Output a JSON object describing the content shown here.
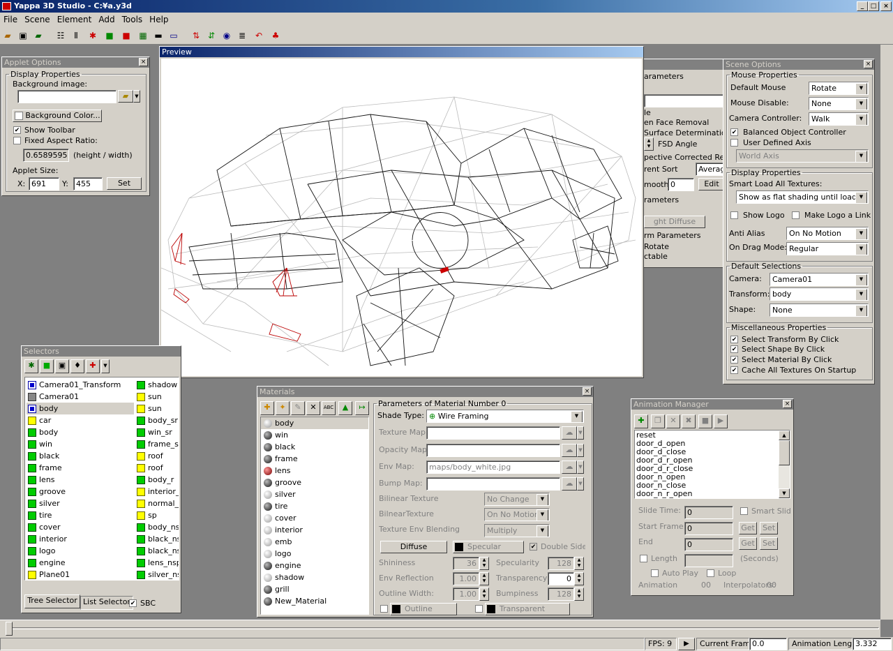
{
  "window": {
    "title": "Yappa 3D Studio - C:¥a.y3d"
  },
  "menu": [
    "File",
    "Scene",
    "Element",
    "Add",
    "Tools",
    "Help"
  ],
  "applet_options": {
    "title": "Applet Options",
    "display_properties": "Display Properties",
    "background_image_label": "Background image:",
    "background_image_value": "",
    "background_color_button": "Background Color...",
    "show_toolbar": "Show Toolbar",
    "fixed_aspect_ratio": "Fixed Aspect Ratio:",
    "ratio_value": "0.6589595",
    "ratio_hint": "(height / width)",
    "applet_size": "Applet Size:",
    "x_label": "X:",
    "x_value": "691",
    "y_label": "Y:",
    "y_value": "455",
    "set_button": "Set"
  },
  "preview": {
    "title": "Preview"
  },
  "hidden_panel": {
    "parameters": "arameters",
    "le": "le",
    "face_removal": "en Face Removal",
    "surface_det": "Surface Determination",
    "fsd_angle": "FSD Angle",
    "perspective": "pective Corrected Ren",
    "current_sort": "rent Sort",
    "sort_value": "Averag",
    "smooth": "mooth:",
    "smooth_value": "0",
    "edit_button": "Edit",
    "parameters2": "rameters",
    "light_diffuse": "ght Diffuse",
    "form_params": "rm Parameters",
    "rotate": "Rotate",
    "selectable": "ctable"
  },
  "scene_options": {
    "title": "Scene Options",
    "mouse_properties": "Mouse Properties",
    "default_mouse_label": "Default Mouse",
    "default_mouse": "Rotate",
    "mouse_disable_label": "Mouse Disable:",
    "mouse_disable": "None",
    "camera_controller_label": "Camera Controller:",
    "camera_controller": "Walk",
    "balanced": "Balanced Object Controller",
    "user_axis": "User Defined Axis",
    "world_axis": "World Axis",
    "display_properties": "Display Properties",
    "smart_load": "Smart Load All Textures:",
    "smart_load_value": "Show as flat shading until loaded",
    "show_logo": "Show Logo",
    "make_logo_link": "Make Logo a Link",
    "anti_alias_label": "Anti Alias",
    "anti_alias": "On No Motion",
    "on_drag_label": "On Drag Mode:",
    "on_drag": "Regular",
    "default_selections": "Default Selections",
    "camera_label": "Camera:",
    "camera": "Camera01",
    "transform_label": "Transform:",
    "transform": "body",
    "shape_label": "Shape:",
    "shape": "None",
    "misc": "Miscellaneous Properties",
    "sel_transform": "Select Transform By Click",
    "sel_shape": "Select Shape By Click",
    "sel_material": "Select Material By Click",
    "cache": "Cache All Textures On Startup"
  },
  "selectors": {
    "title": "Selectors",
    "col1": [
      {
        "name": "Camera01_Transform",
        "icon": "tr"
      },
      {
        "name": "Camera01",
        "icon": "cam"
      },
      {
        "name": "body",
        "icon": "tr"
      },
      {
        "name": "car",
        "icon": "light"
      },
      {
        "name": "body",
        "icon": "cube"
      },
      {
        "name": "win",
        "icon": "cube"
      },
      {
        "name": "black",
        "icon": "cube"
      },
      {
        "name": "frame",
        "icon": "cube"
      },
      {
        "name": "lens",
        "icon": "cube"
      },
      {
        "name": "groove",
        "icon": "cube"
      },
      {
        "name": "silver",
        "icon": "cube"
      },
      {
        "name": "tire",
        "icon": "cube"
      },
      {
        "name": "cover",
        "icon": "cube"
      },
      {
        "name": "interior",
        "icon": "cube"
      },
      {
        "name": "logo",
        "icon": "cube"
      },
      {
        "name": "engine",
        "icon": "cube"
      },
      {
        "name": "Plane01",
        "icon": "light"
      }
    ],
    "col2": [
      {
        "name": "shadow",
        "icon": "cube"
      },
      {
        "name": "sun",
        "icon": "light"
      },
      {
        "name": "sun",
        "icon": "light"
      },
      {
        "name": "body_sr",
        "icon": "cube"
      },
      {
        "name": "win_sr",
        "icon": "cube"
      },
      {
        "name": "frame_sr",
        "icon": "cube"
      },
      {
        "name": "roof",
        "icon": "light"
      },
      {
        "name": "roof",
        "icon": "light"
      },
      {
        "name": "body_r",
        "icon": "cube"
      },
      {
        "name": "interior_r",
        "icon": "light"
      },
      {
        "name": "normal_s",
        "icon": "light"
      },
      {
        "name": "sp",
        "icon": "light"
      },
      {
        "name": "body_nsp",
        "icon": "cube"
      },
      {
        "name": "black_ns",
        "icon": "cube"
      },
      {
        "name": "black_ns",
        "icon": "cube"
      },
      {
        "name": "lens_nsp",
        "icon": "cube"
      },
      {
        "name": "silver_ns",
        "icon": "cube"
      }
    ],
    "tab_tree": "Tree Selector",
    "tab_list": "List Selector",
    "sbc": "SBC"
  },
  "materials": {
    "title": "Materials",
    "list": [
      {
        "name": "body",
        "icon": "gry"
      },
      {
        "name": "win",
        "icon": "blk"
      },
      {
        "name": "black",
        "icon": "blk"
      },
      {
        "name": "frame",
        "icon": "blk"
      },
      {
        "name": "lens",
        "icon": "red"
      },
      {
        "name": "groove",
        "icon": "blk"
      },
      {
        "name": "silver",
        "icon": "gry"
      },
      {
        "name": "tire",
        "icon": "blk"
      },
      {
        "name": "cover",
        "icon": "gry"
      },
      {
        "name": "interior",
        "icon": "gry"
      },
      {
        "name": "emb",
        "icon": "gry"
      },
      {
        "name": "logo",
        "icon": "gry"
      },
      {
        "name": "engine",
        "icon": "blk"
      },
      {
        "name": "shadow",
        "icon": "gry"
      },
      {
        "name": "grill",
        "icon": "blk"
      },
      {
        "name": "New_Material",
        "icon": "blk"
      }
    ],
    "params_title": "Parameters of Material Number 0",
    "shade_type_label": "Shade Type:",
    "shade_type": "Wire Framing",
    "texture_map": "Texture Map:",
    "opacity_map": "Opacity Map:",
    "env_map": "Env Map:",
    "env_map_value": "maps/body_white.jpg",
    "bump_map": "Bump Map:",
    "bilinear_texture": "Bilinear Texture",
    "bilinear_texture_value": "No Change",
    "bilinear_texture2": "BilnearTexture",
    "bilinear_texture2_value": "On No Motion",
    "tex_env_blend": "Texture Env Blending",
    "tex_env_blend_value": "Multiply",
    "diffuse": "Diffuse",
    "specular": "Specular",
    "double_sided": "Double Sided",
    "shininess": "Shininess",
    "shininess_value": "36",
    "specularity": "Specularity",
    "specularity_value": "128",
    "env_reflection": "Env Reflection",
    "env_reflection_value": "1.00",
    "transparency": "Transparency",
    "transparency_value": "0",
    "outline_width": "Outline Width:",
    "outline_width_value": "1.00",
    "bumpiness": "Bumpiness",
    "bumpiness_value": "128",
    "outline": "Outline",
    "transparent": "Transparent"
  },
  "animation": {
    "title": "Animation Manager",
    "items": [
      "reset",
      "door_d_open",
      "door_d_close",
      "door_d_r_open",
      "door_d_r_close",
      "door_n_open",
      "door_n_close",
      "door_n_r_open"
    ],
    "slide_time": "Slide Time:",
    "slide_time_value": "0",
    "smart_slide": "Smart Slide",
    "start_frame": "Start Frame:",
    "start_frame_value": "0",
    "end": "End",
    "end_value": "0",
    "get": "Get",
    "set": "Set",
    "length": "Length",
    "seconds": "(Seconds)",
    "auto_play": "Auto Play",
    "loop": "Loop",
    "animation_label": "Animation",
    "animation_value": "00",
    "interpolators_label": "Interpolators:",
    "interpolators_value": "00"
  },
  "status": {
    "fps": "FPS: 9",
    "current_frame_label": "Current Frame",
    "current_frame": "0.0",
    "anim_length_label": "Animation Length",
    "anim_length": "3.332"
  }
}
